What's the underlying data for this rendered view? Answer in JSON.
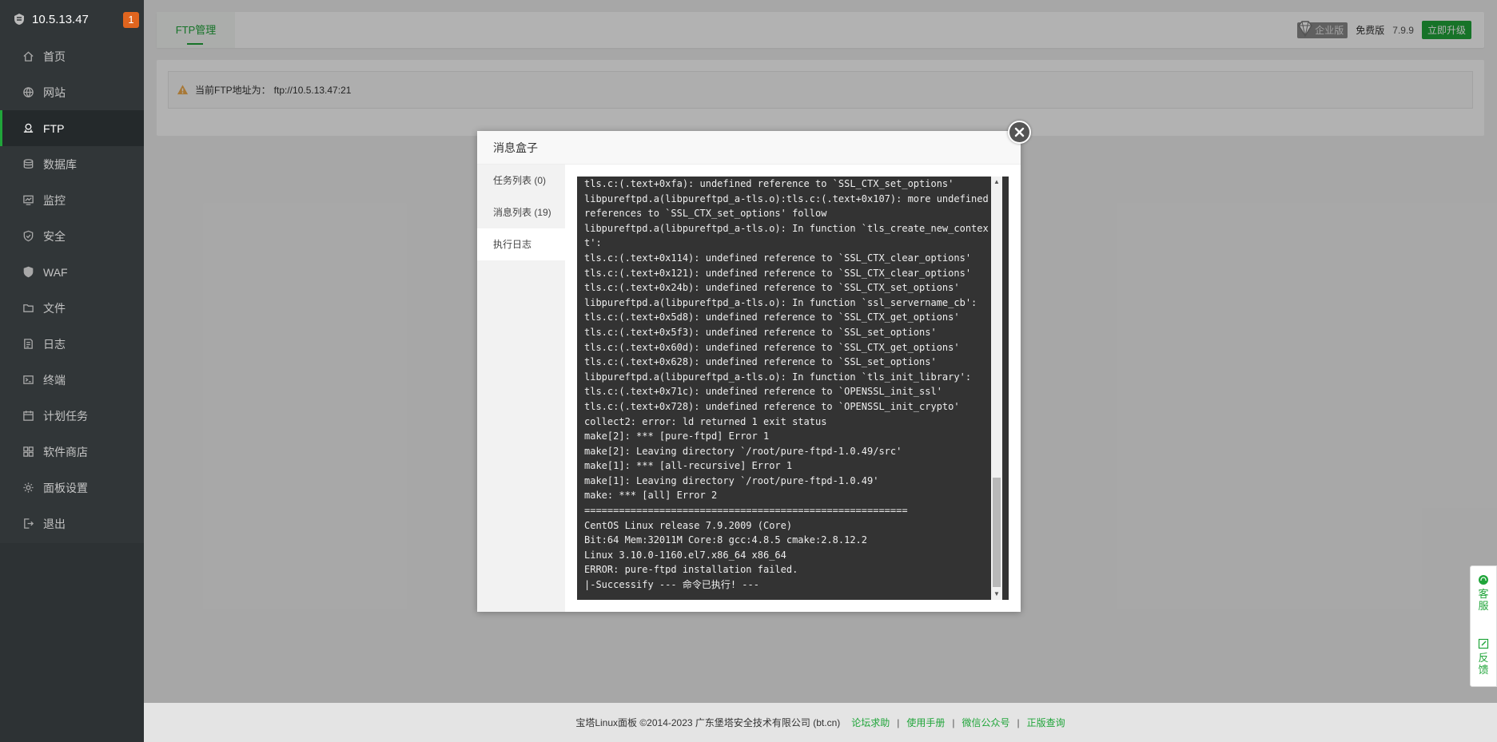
{
  "sidebar": {
    "host": "10.5.13.47",
    "badge": "1",
    "items": [
      {
        "label": "首页",
        "icon": "home-icon"
      },
      {
        "label": "网站",
        "icon": "globe-icon"
      },
      {
        "label": "FTP",
        "icon": "ftp-icon"
      },
      {
        "label": "数据库",
        "icon": "database-icon"
      },
      {
        "label": "监控",
        "icon": "monitor-icon"
      },
      {
        "label": "安全",
        "icon": "shield-icon"
      },
      {
        "label": "WAF",
        "icon": "waf-shield-icon"
      },
      {
        "label": "文件",
        "icon": "folder-icon"
      },
      {
        "label": "日志",
        "icon": "log-icon"
      },
      {
        "label": "终端",
        "icon": "terminal-icon"
      },
      {
        "label": "计划任务",
        "icon": "calendar-icon"
      },
      {
        "label": "软件商店",
        "icon": "apps-icon"
      },
      {
        "label": "面板设置",
        "icon": "gear-icon"
      },
      {
        "label": "退出",
        "icon": "logout-icon"
      }
    ],
    "active_index": 2
  },
  "topbar": {
    "tab": "FTP管理",
    "enterprise": "企业版",
    "free": "免费版",
    "version": "7.9.9",
    "upgrade": "立即升级"
  },
  "notice": {
    "label": "当前FTP地址为：",
    "address": "ftp://10.5.13.47:21"
  },
  "dialog": {
    "title": "消息盒子",
    "nav": [
      "任务列表 (0)",
      "消息列表 (19)",
      "执行日志"
    ],
    "active_nav": 2,
    "log_lines": [
      "tls.c:(.text+0xfa): undefined reference to `SSL_CTX_set_options'",
      "libpureftpd.a(libpureftpd_a-tls.o):tls.c:(.text+0x107): more undefined",
      "references to `SSL_CTX_set_options' follow",
      "libpureftpd.a(libpureftpd_a-tls.o): In function `tls_create_new_contex",
      "t':",
      "tls.c:(.text+0x114): undefined reference to `SSL_CTX_clear_options'",
      "tls.c:(.text+0x121): undefined reference to `SSL_CTX_clear_options'",
      "tls.c:(.text+0x24b): undefined reference to `SSL_CTX_set_options'",
      "libpureftpd.a(libpureftpd_a-tls.o): In function `ssl_servername_cb':",
      "tls.c:(.text+0x5d8): undefined reference to `SSL_CTX_get_options'",
      "tls.c:(.text+0x5f3): undefined reference to `SSL_set_options'",
      "tls.c:(.text+0x60d): undefined reference to `SSL_CTX_get_options'",
      "tls.c:(.text+0x628): undefined reference to `SSL_set_options'",
      "libpureftpd.a(libpureftpd_a-tls.o): In function `tls_init_library':",
      "tls.c:(.text+0x71c): undefined reference to `OPENSSL_init_ssl'",
      "tls.c:(.text+0x728): undefined reference to `OPENSSL_init_crypto'",
      "collect2: error: ld returned 1 exit status",
      "make[2]: *** [pure-ftpd] Error 1",
      "make[2]: Leaving directory `/root/pure-ftpd-1.0.49/src'",
      "make[1]: *** [all-recursive] Error 1",
      "make[1]: Leaving directory `/root/pure-ftpd-1.0.49'",
      "make: *** [all] Error 2",
      "========================================================",
      "CentOS Linux release 7.9.2009 (Core)",
      "Bit:64 Mem:32011M Core:8 gcc:4.8.5 cmake:2.8.12.2",
      "Linux 3.10.0-1160.el7.x86_64 x86_64",
      "ERROR: pure-ftpd installation failed.",
      "|-Successify --- 命令已执行! ---"
    ]
  },
  "side_tools": [
    "客服",
    "反馈"
  ],
  "footer": {
    "copyright": "宝塔Linux面板 ©2014-2023 广东堡塔安全技术有限公司 (bt.cn)",
    "links": [
      "论坛求助",
      "使用手册",
      "微信公众号",
      "正版查询"
    ]
  },
  "colors": {
    "accent": "#20a53a",
    "sidebar_bg": "#313638",
    "badge": "#e0651f",
    "console_bg": "#333333"
  }
}
